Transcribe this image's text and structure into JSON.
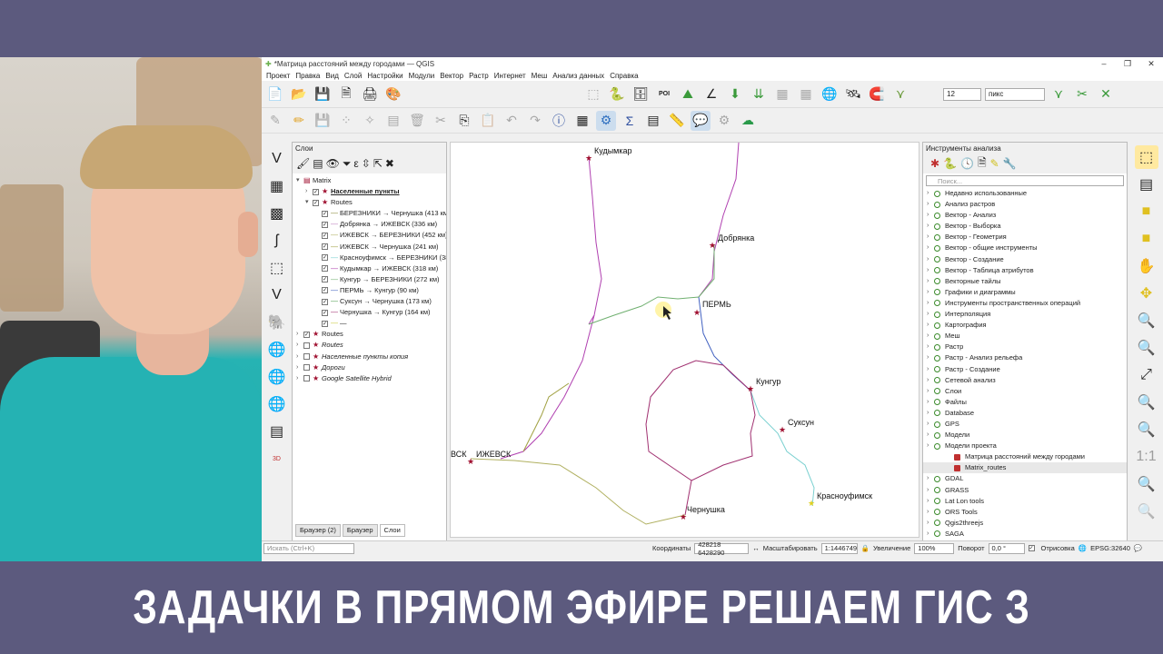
{
  "window": {
    "title": "*Матрица расстояний между городами — QGIS",
    "controls": [
      "–",
      "❐",
      "✕"
    ]
  },
  "menu": [
    "Проект",
    "Правка",
    "Вид",
    "Слой",
    "Настройки",
    "Модули",
    "Вектор",
    "Растр",
    "Интернет",
    "Меш",
    "Анализ данных",
    "Справка"
  ],
  "toolbar": {
    "size_value": "12",
    "unit_value": "пикс"
  },
  "layers_panel": {
    "title": "Слои",
    "items": [
      {
        "label": "Matrix",
        "level": 0,
        "checked": null,
        "expanded": true
      },
      {
        "label": "Населенные пункты",
        "level": 1,
        "checked": true
      },
      {
        "label": "Routes",
        "level": 1,
        "checked": true,
        "expanded": true
      },
      {
        "label": "БЕРЕЗНИКИ → Чернушка (413 км)",
        "level": 2,
        "checked": true,
        "color": "#8a8a3a"
      },
      {
        "label": "Добрянка → ИЖЕВСК (336 км)",
        "level": 2,
        "checked": true,
        "color": "#c080c0"
      },
      {
        "label": "ИЖЕВСК → БЕРЕЗНИКИ (452 км)",
        "level": 2,
        "checked": true,
        "color": "#b0b060"
      },
      {
        "label": "ИЖЕВСК → Чернушка (241 км)",
        "level": 2,
        "checked": true,
        "color": "#a0a040"
      },
      {
        "label": "Красноуфимск → БЕРЕЗНИКИ (38",
        "level": 2,
        "checked": true,
        "color": "#7ad0d0"
      },
      {
        "label": "Кудымкар → ИЖЕВСК (318 км)",
        "level": 2,
        "checked": true,
        "color": "#b040b0"
      },
      {
        "label": "Кунгур → БЕРЕЗНИКИ (272 км)",
        "level": 2,
        "checked": true,
        "color": "#70b070"
      },
      {
        "label": "ПЕРМЬ → Кунгур (90 км)",
        "level": 2,
        "checked": true,
        "color": "#4060c0"
      },
      {
        "label": "Суксун → Чернушка (173 км)",
        "level": 2,
        "checked": true,
        "color": "#50a050"
      },
      {
        "label": "Чернушка → Кунгур (164 км)",
        "level": 2,
        "checked": true,
        "color": "#a03070"
      },
      {
        "label": "—",
        "level": 2,
        "checked": true,
        "color": "#cccc40"
      },
      {
        "label": "Routes",
        "level": 0,
        "checked": true
      },
      {
        "label": "Routes",
        "level": 0,
        "checked": false,
        "italic": true
      },
      {
        "label": "Населенные пункты копия",
        "level": 0,
        "checked": false,
        "italic": true
      },
      {
        "label": "Дороги",
        "level": 0,
        "checked": false,
        "italic": true
      },
      {
        "label": "Google Satellite Hybrid",
        "level": 0,
        "checked": false,
        "italic": true
      }
    ],
    "tabs": [
      "Браузер (2)",
      "Браузер",
      "Слои"
    ]
  },
  "map": {
    "cities": [
      {
        "name": "Кудымкар"
      },
      {
        "name": "Добрянка"
      },
      {
        "name": "ПЕРМЬ"
      },
      {
        "name": "Кунгур"
      },
      {
        "name": "Суксун"
      },
      {
        "name": "ИЖЕВСК"
      },
      {
        "name": "ВСК"
      },
      {
        "name": "Чернушка"
      },
      {
        "name": "Красноуфимск"
      }
    ]
  },
  "tools_panel": {
    "title": "Инструменты анализа",
    "search_placeholder": "Поиск...",
    "items": [
      {
        "label": "Недавно использованные",
        "sub": false
      },
      {
        "label": "Анализ растров",
        "sub": false
      },
      {
        "label": "Вектор - Анализ",
        "sub": false
      },
      {
        "label": "Вектор - Выборка",
        "sub": false
      },
      {
        "label": "Вектор - Геометрия",
        "sub": false
      },
      {
        "label": "Вектор - общие инструменты",
        "sub": false
      },
      {
        "label": "Вектор - Создание",
        "sub": false
      },
      {
        "label": "Вектор - Таблица атрибутов",
        "sub": false
      },
      {
        "label": "Векторные тайлы",
        "sub": false
      },
      {
        "label": "Графики и диаграммы",
        "sub": false
      },
      {
        "label": "Инструменты пространственных операций",
        "sub": false
      },
      {
        "label": "Интерполяция",
        "sub": false
      },
      {
        "label": "Картография",
        "sub": false
      },
      {
        "label": "Меш",
        "sub": false
      },
      {
        "label": "Растр",
        "sub": false
      },
      {
        "label": "Растр - Анализ рельефа",
        "sub": false
      },
      {
        "label": "Растр - Создание",
        "sub": false
      },
      {
        "label": "Сетевой анализ",
        "sub": false
      },
      {
        "label": "Слои",
        "sub": false
      },
      {
        "label": "Файлы",
        "sub": false
      },
      {
        "label": "Database",
        "sub": false
      },
      {
        "label": "GPS",
        "sub": false
      },
      {
        "label": "Модели",
        "sub": false
      },
      {
        "label": "Модели проекта",
        "sub": false
      },
      {
        "label": "Матрица расстояний между городами",
        "sub": true
      },
      {
        "label": "Matrix_routes",
        "sub": true,
        "selected": true
      },
      {
        "label": "GDAL",
        "sub": false
      },
      {
        "label": "GRASS",
        "sub": false
      },
      {
        "label": "Lat Lon tools",
        "sub": false
      },
      {
        "label": "ORS Tools",
        "sub": false
      },
      {
        "label": "Qgis2threejs",
        "sub": false
      },
      {
        "label": "SAGA",
        "sub": false
      }
    ]
  },
  "status": {
    "search_placeholder": "Искать (Ctrl+K)",
    "coord_label": "Координаты",
    "coord_value": "428218 6428290",
    "scale_label": "Масштабировать",
    "scale_value": "1:1446749",
    "zoom_label": "Увеличение",
    "zoom_value": "100%",
    "rotation_label": "Поворот",
    "rotation_value": "0,0 °",
    "render_label": "Отрисовка",
    "crs": "EPSG:32640"
  },
  "banner": {
    "text": "ЗАДАЧКИ В ПРЯМОМ ЭФИРЕ РЕШАЕМ ГИС З"
  },
  "colors": {
    "background": "#5c5a7e",
    "city_marker": "#a01030",
    "accent_green": "#3a8a2a"
  }
}
